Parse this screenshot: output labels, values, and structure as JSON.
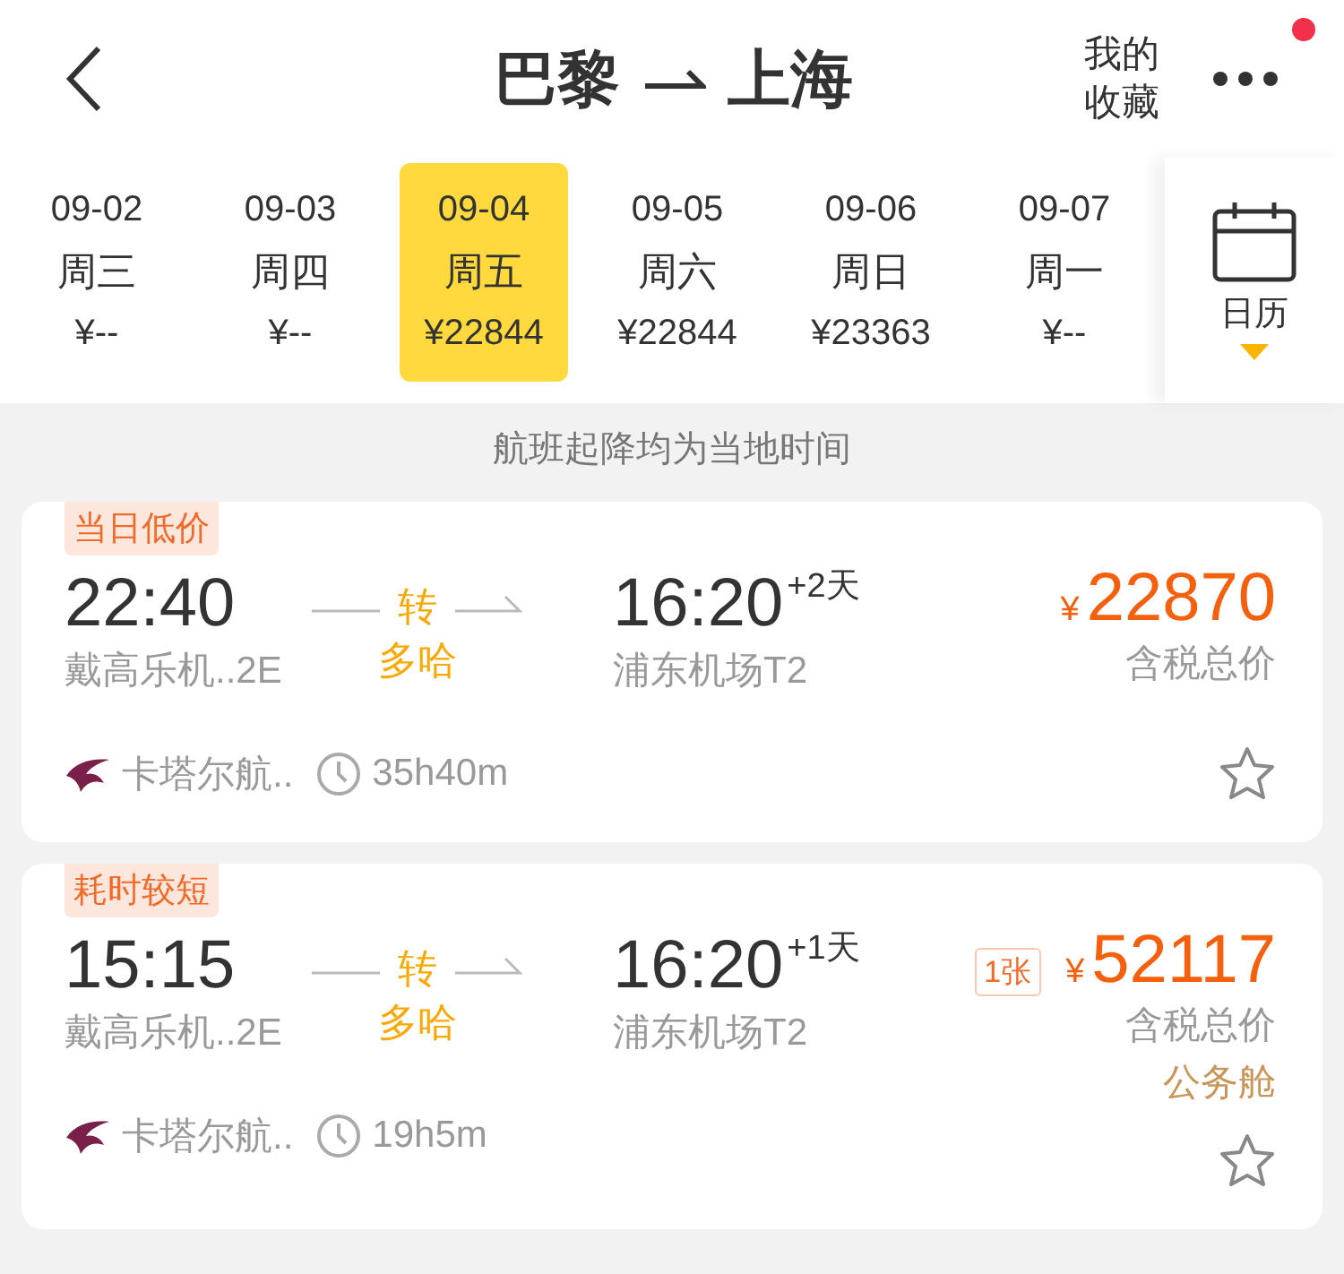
{
  "header": {
    "origin": "巴黎",
    "destination": "上海",
    "favorites_label": "我的收藏",
    "notification_dot": true
  },
  "dates": [
    {
      "date": "09-02",
      "weekday": "周三",
      "price": "¥--",
      "selected": false
    },
    {
      "date": "09-03",
      "weekday": "周四",
      "price": "¥--",
      "selected": false
    },
    {
      "date": "09-04",
      "weekday": "周五",
      "price": "¥22844",
      "selected": true
    },
    {
      "date": "09-05",
      "weekday": "周六",
      "price": "¥22844",
      "selected": false
    },
    {
      "date": "09-06",
      "weekday": "周日",
      "price": "¥23363",
      "selected": false
    },
    {
      "date": "09-07",
      "weekday": "周一",
      "price": "¥--",
      "selected": false
    }
  ],
  "calendar_label": "日历",
  "notice": "航班起降均为当地时间",
  "flights": [
    {
      "tag": "当日低价",
      "dep_time": "22:40",
      "dep_airport": "戴高乐机..2E",
      "transfer_label": "转",
      "transfer_city": "多哈",
      "arr_time": "16:20",
      "day_offset": "+2天",
      "arr_airport": "浦东机场T2",
      "currency": "¥",
      "price": "22870",
      "price_note": "含税总价",
      "airline": "卡塔尔航..",
      "duration": "35h40m",
      "favorited": false
    },
    {
      "tag": "耗时较短",
      "dep_time": "15:15",
      "dep_airport": "戴高乐机..2E",
      "transfer_label": "转",
      "transfer_city": "多哈",
      "arr_time": "16:20",
      "day_offset": "+1天",
      "arr_airport": "浦东机场T2",
      "ticket_count": "1张",
      "currency": "¥",
      "price": "52117",
      "price_note": "含税总价",
      "cabin": "公务舱",
      "airline": "卡塔尔航..",
      "duration": "19h5m",
      "favorited": false
    }
  ]
}
